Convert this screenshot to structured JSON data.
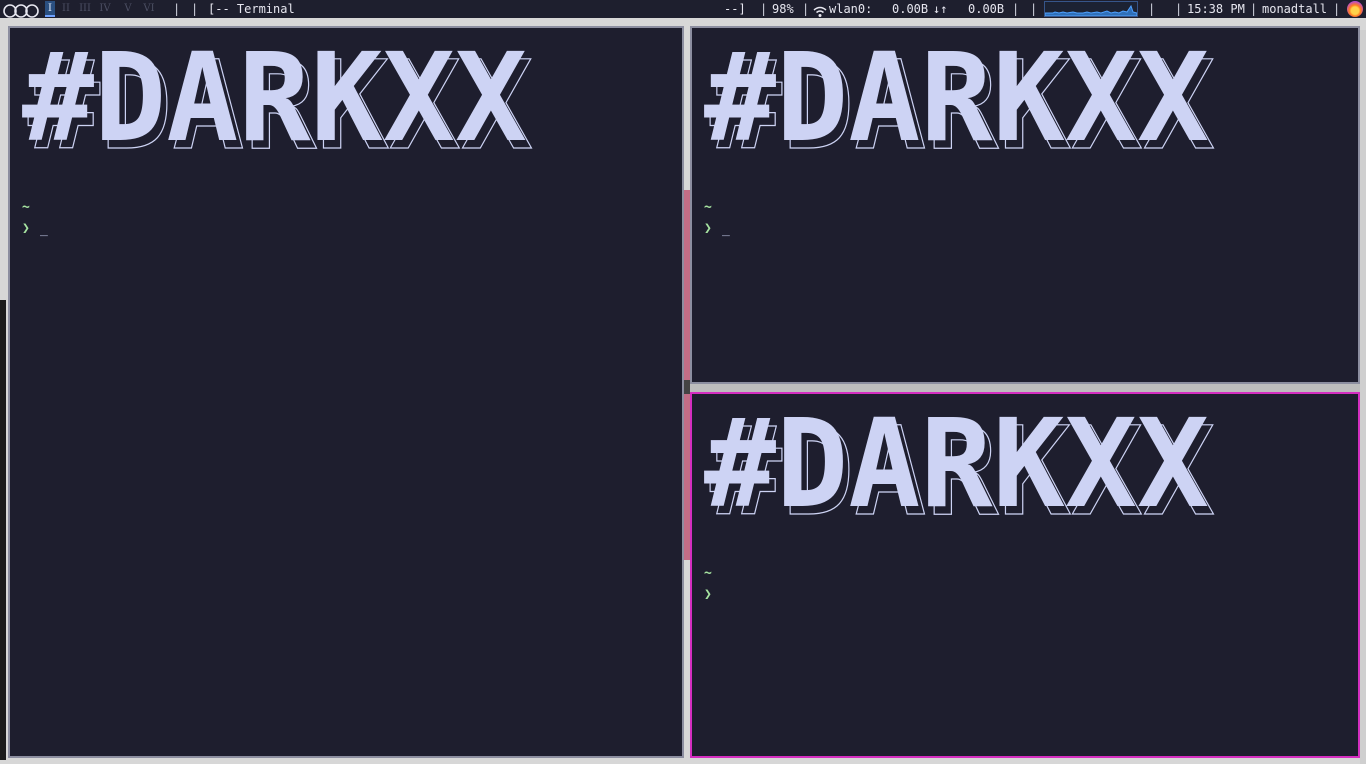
{
  "colors": {
    "bar_bg": "#1e1f2e",
    "terminal_bg": "#1e1e2e",
    "banner_fill": "#cdd3f4",
    "prompt_green": "#a6e3a1",
    "focused_border": "#d42ec0",
    "unfocused_border": "#8c8ea0",
    "active_workspace": "#2a4f80"
  },
  "bar": {
    "workspaces": [
      "I",
      "II",
      "III",
      "IV",
      "V",
      "VI"
    ],
    "sep1": "|",
    "sep2": "|",
    "window_title": "[-- Terminal",
    "window_title_end": "--]",
    "sep3": "|",
    "battery": "98%",
    "sep4": "|",
    "net_iface": "wlan0:",
    "net_down": "0.00B",
    "net_arrows": "↓↑",
    "net_up": "0.00B",
    "sep5": "|",
    "sep6": "|",
    "sep7": "|",
    "sep8": "|",
    "clock": "15:38 PM",
    "sep9": "|",
    "layout": "monadtall",
    "sep10": "|"
  },
  "terminals": [
    {
      "banner": "#DARKXX",
      "tilde": "~",
      "arrow": "❯",
      "cursor": "_"
    },
    {
      "banner": "#DARKXX",
      "tilde": "~",
      "arrow": "❯",
      "cursor": "_"
    },
    {
      "banner": "#DARKXX",
      "tilde": "~",
      "arrow": "❯",
      "cursor": ""
    }
  ]
}
